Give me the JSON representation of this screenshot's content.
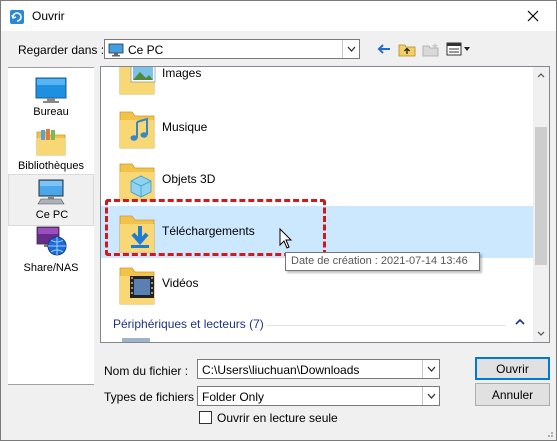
{
  "window": {
    "title": "Ouvrir"
  },
  "toolbar": {
    "lookin_label": "Regarder dans :",
    "lookin_value": "Ce PC"
  },
  "places": [
    {
      "label": "Bureau",
      "icon": "desktop-icon"
    },
    {
      "label": "Bibliothèques",
      "icon": "libraries-icon"
    },
    {
      "label": "Ce PC",
      "icon": "computer-icon",
      "selected": true
    },
    {
      "label": "Share/NAS",
      "icon": "network-globe-icon"
    }
  ],
  "files": [
    {
      "name": "Images",
      "icon": "pictures-folder-icon"
    },
    {
      "name": "Musique",
      "icon": "music-folder-icon"
    },
    {
      "name": "Objets 3D",
      "icon": "3d-objects-folder-icon"
    },
    {
      "name": "Téléchargements",
      "icon": "downloads-folder-icon",
      "selected": true
    },
    {
      "name": "Vidéos",
      "icon": "videos-folder-icon"
    }
  ],
  "group_header": "Périphériques et lecteurs (7)",
  "tooltip": "Date de création : 2021-07-14 13:46",
  "form": {
    "filename_label": "Nom du fichier :",
    "filename_value": "C:\\Users\\liuchuan\\Downloads",
    "filetype_label": "Types de fichiers :",
    "filetype_value": "Folder Only",
    "readonly_label": "Ouvrir en lecture seule",
    "open_button": "Ouvrir",
    "cancel_button": "Annuler"
  },
  "colors": {
    "selection": "#cce8ff",
    "highlight_dash": "#d0191d",
    "group_header": "#1e3287",
    "folder": "#f8d775"
  }
}
